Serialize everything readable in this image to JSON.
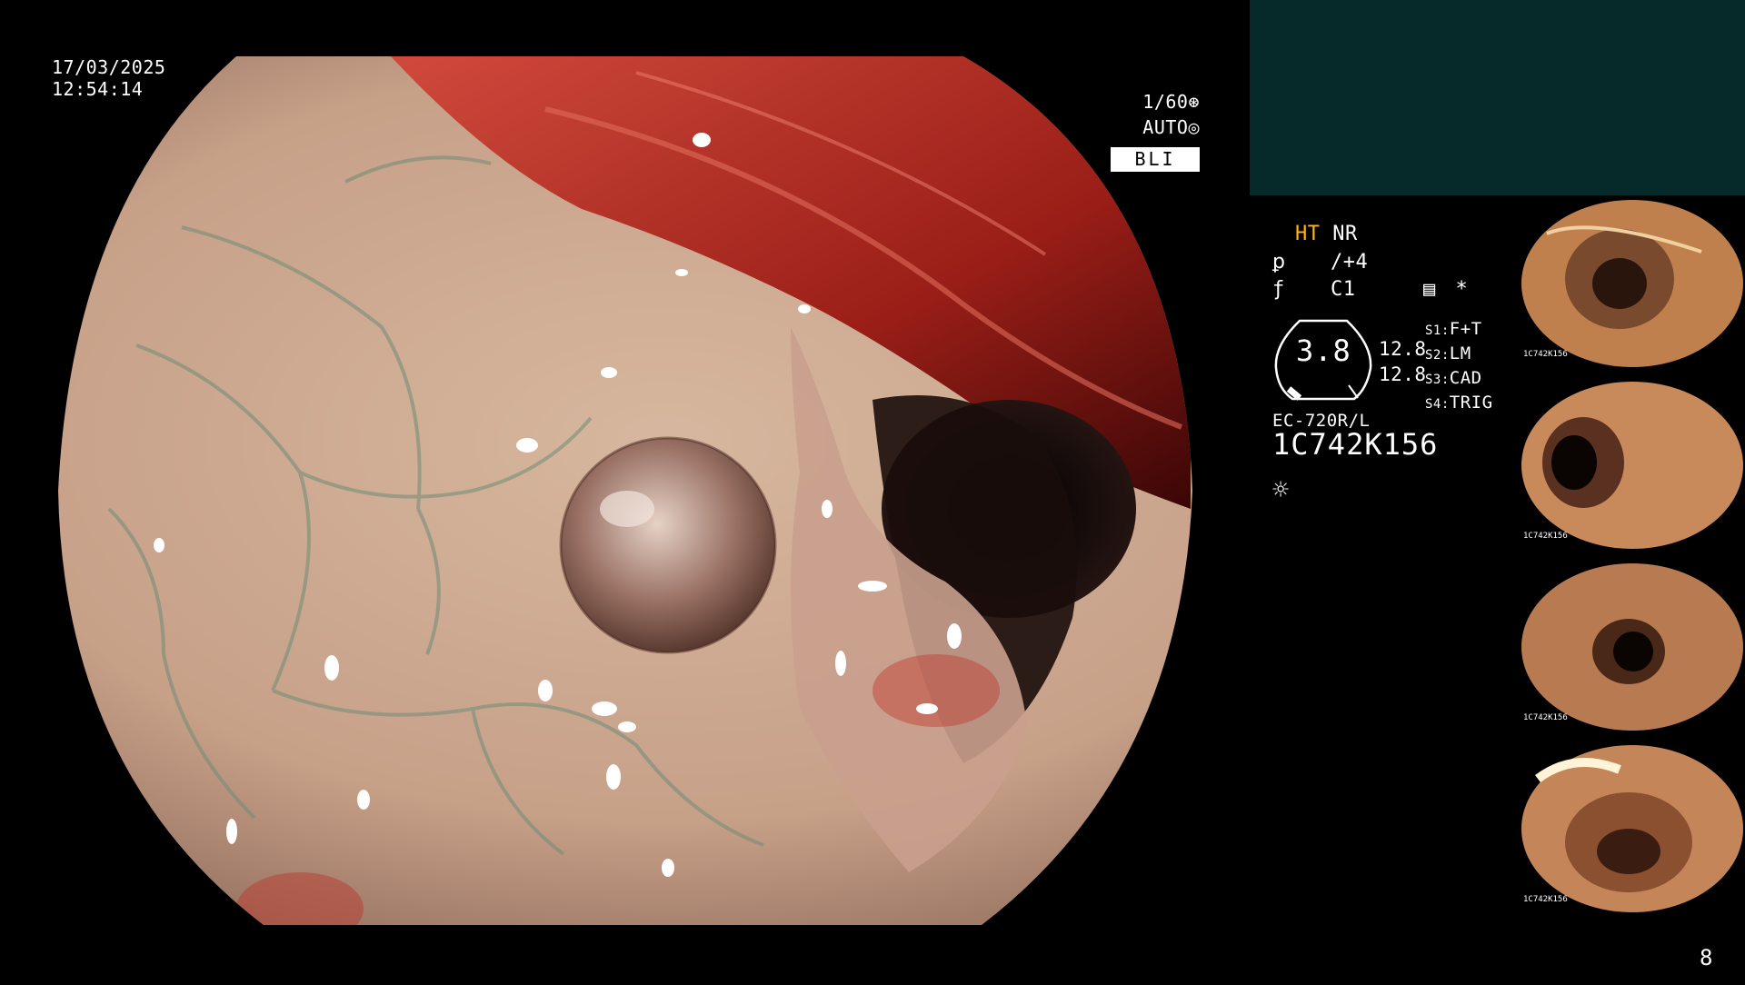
{
  "overlay": {
    "date": "17/03/2025",
    "time": "12:54:14",
    "shutter": "1/60",
    "iris": "AUTO",
    "mode": "BLI"
  },
  "panel": {
    "ht": "HT",
    "nr": "NR",
    "enhance": "/+4",
    "color": "C1",
    "star": "*",
    "zoom": "3.8",
    "value_1": "12.8",
    "value_2": "12.8",
    "switches": [
      {
        "key": "S1:",
        "value": "F+T"
      },
      {
        "key": "S2:",
        "value": "LM"
      },
      {
        "key": "S3:",
        "value": "CAD"
      },
      {
        "key": "S4:",
        "value": "TRIG"
      }
    ],
    "scope_model": "EC-720R/L",
    "serial": "1C742K156"
  },
  "thumbnails": [
    {
      "label": "1C742K156"
    },
    {
      "label": "1C742K156"
    },
    {
      "label": "1C742K156"
    },
    {
      "label": "1C742K156"
    }
  ],
  "page_number": "8",
  "colors": {
    "accent": "#ffb21e",
    "top_panel": "#062a29",
    "mucosa": "#c9a58e",
    "vessel": "#7a8f7a"
  },
  "icons": [
    "shutter-icon",
    "iris-icon",
    "enhance-icon",
    "color-icon",
    "memory-icon",
    "light-icon"
  ]
}
